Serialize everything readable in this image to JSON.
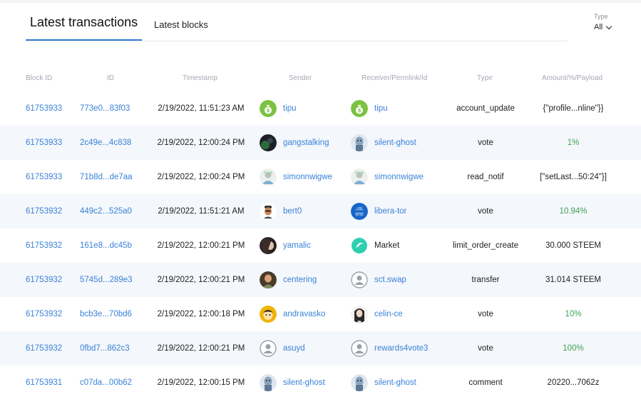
{
  "tabs": [
    {
      "label": "Latest transactions"
    },
    {
      "label": "Latest blocks"
    }
  ],
  "type_filter": {
    "label": "Type",
    "value": "All"
  },
  "columns": [
    "Block ID",
    "ID",
    "Timestamp",
    "Sender",
    "Receiver/Permlink/Id",
    "Type",
    "Amount/%/Payload"
  ],
  "rows": [
    {
      "block_id": "61753933",
      "id": "773e0...83f03",
      "timestamp": "2/19/2022, 11:51:23 AM",
      "sender": "tipu",
      "receiver": "tipu",
      "type": "account_update",
      "amount": "{\"profile...nline\"}}"
    },
    {
      "block_id": "61753933",
      "id": "2c49e...4c838",
      "timestamp": "2/19/2022, 12:00:24 PM",
      "sender": "gangstalking",
      "receiver": "silent-ghost",
      "type": "vote",
      "amount": "1%"
    },
    {
      "block_id": "61753933",
      "id": "71b8d...de7aa",
      "timestamp": "2/19/2022, 12:00:24 PM",
      "sender": "simonnwigwe",
      "receiver": "simonnwigwe",
      "type": "read_notif",
      "amount": "[\"setLast...50:24\"}]"
    },
    {
      "block_id": "61753932",
      "id": "449c2...525a0",
      "timestamp": "2/19/2022, 11:51:21 AM",
      "sender": "bert0",
      "receiver": "libera-tor",
      "type": "vote",
      "amount": "10.94%"
    },
    {
      "block_id": "61753932",
      "id": "161e8...dc45b",
      "timestamp": "2/19/2022, 12:00:21 PM",
      "sender": "yamalic",
      "receiver": "Market",
      "type": "limit_order_create",
      "amount": "30.000 STEEM"
    },
    {
      "block_id": "61753932",
      "id": "5745d...289e3",
      "timestamp": "2/19/2022, 12:00:21 PM",
      "sender": "centering",
      "receiver": "sct.swap",
      "type": "transfer",
      "amount": "31.014 STEEM"
    },
    {
      "block_id": "61753932",
      "id": "bcb3e...70bd6",
      "timestamp": "2/19/2022, 12:00:18 PM",
      "sender": "andravasko",
      "receiver": "celin-ce",
      "type": "vote",
      "amount": "10%"
    },
    {
      "block_id": "61753932",
      "id": "0fbd7...862c3",
      "timestamp": "2/19/2022, 12:00:21 PM",
      "sender": "asuyd",
      "receiver": "rewards4vote3",
      "type": "vote",
      "amount": "100%"
    },
    {
      "block_id": "61753931",
      "id": "c07da...00b62",
      "timestamp": "2/19/2022, 12:00:15 PM",
      "sender": "silent-ghost",
      "receiver": "silent-ghost",
      "type": "comment",
      "amount": "20220...7062z"
    }
  ],
  "avatar_badge_text": "리베\n레이터",
  "colors": {
    "link": "#3a82d8",
    "percent_green": "#3ea356",
    "tab_underline": "#2f7fd6",
    "alt_row": "#f4f7fb"
  }
}
